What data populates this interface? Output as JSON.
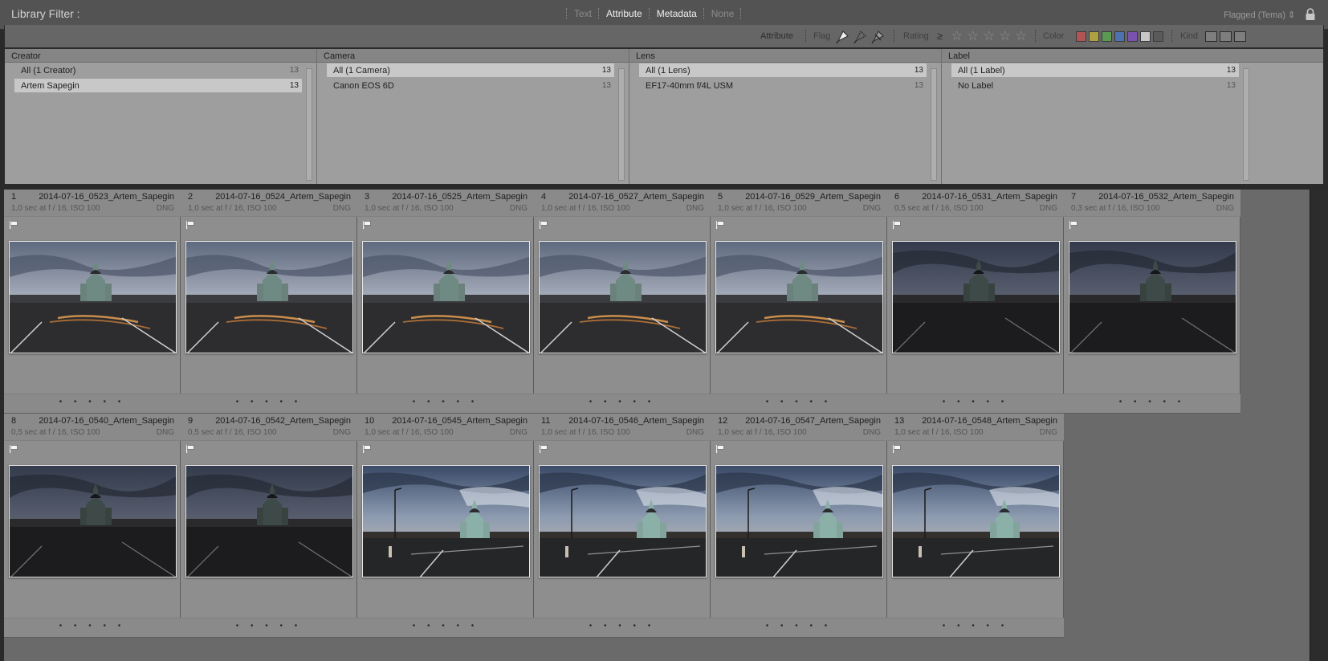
{
  "filter_bar": {
    "title": "Library Filter :",
    "modes": [
      {
        "label": "Text",
        "active": false
      },
      {
        "label": "Attribute",
        "active": true
      },
      {
        "label": "Metadata",
        "active": true
      },
      {
        "label": "None",
        "active": false
      }
    ],
    "preset": "Flagged (Tema) ⇕"
  },
  "attribute_bar": {
    "label": "Attribute",
    "flag_label": "Flag",
    "rating_label": "Rating",
    "rating_op": "≥",
    "stars": [
      "☆",
      "☆",
      "☆",
      "☆",
      "☆"
    ],
    "color_label": "Color",
    "colors": [
      "#b05454",
      "#b0a044",
      "#5c9a54",
      "#4e72b0",
      "#7a52b0",
      "#c8c8c8",
      "#5a5a5a"
    ],
    "kind_label": "Kind"
  },
  "metadata": {
    "columns": [
      {
        "header": "Creator",
        "rows": [
          {
            "label": "All (1 Creator)",
            "count": "13",
            "selected": false
          },
          {
            "label": "Artem Sapegin",
            "count": "13",
            "selected": true
          }
        ]
      },
      {
        "header": "Camera",
        "rows": [
          {
            "label": "All (1 Camera)",
            "count": "13",
            "selected": true
          },
          {
            "label": "Canon EOS 6D",
            "count": "13",
            "selected": false
          }
        ]
      },
      {
        "header": "Lens",
        "rows": [
          {
            "label": "All (1 Lens)",
            "count": "13",
            "selected": true
          },
          {
            "label": "EF17-40mm f/4L USM",
            "count": "13",
            "selected": false
          }
        ]
      },
      {
        "header": "Label",
        "rows": [
          {
            "label": "All (1 Label)",
            "count": "13",
            "selected": true
          },
          {
            "label": "No Label",
            "count": "13",
            "selected": false
          }
        ]
      }
    ]
  },
  "grid": {
    "items": [
      {
        "index": "1",
        "name": "2014-07-16_0523_Artem_Sapegin",
        "info": "1,0 sec at f / 16, ISO 100",
        "ext": "DNG",
        "scene": "a",
        "dots": "• • • • •"
      },
      {
        "index": "2",
        "name": "2014-07-16_0524_Artem_Sapegin",
        "info": "1,0 sec at f / 16, ISO 100",
        "ext": "DNG",
        "scene": "a",
        "dots": "• • • • •"
      },
      {
        "index": "3",
        "name": "2014-07-16_0525_Artem_Sapegin",
        "info": "1,0 sec at f / 16, ISO 100",
        "ext": "DNG",
        "scene": "a",
        "dots": "• • • • •"
      },
      {
        "index": "4",
        "name": "2014-07-16_0527_Artem_Sapegin",
        "info": "1,0 sec at f / 16, ISO 100",
        "ext": "DNG",
        "scene": "a",
        "dots": "• • • • •"
      },
      {
        "index": "5",
        "name": "2014-07-16_0529_Artem_Sapegin",
        "info": "1,0 sec at f / 16, ISO 100",
        "ext": "DNG",
        "scene": "a",
        "dots": "• • • • •"
      },
      {
        "index": "6",
        "name": "2014-07-16_0531_Artem_Sapegin",
        "info": "0,5 sec at f / 16, ISO 100",
        "ext": "DNG",
        "scene": "b",
        "dots": "• • • • •"
      },
      {
        "index": "7",
        "name": "2014-07-16_0532_Artem_Sapegin",
        "info": "0,3 sec at f / 16, ISO 100",
        "ext": "DNG",
        "scene": "b",
        "dots": "• • • • •"
      },
      {
        "index": "8",
        "name": "2014-07-16_0540_Artem_Sapegin",
        "info": "0,5 sec at f / 16, ISO 100",
        "ext": "DNG",
        "scene": "b",
        "dots": "• • • • •"
      },
      {
        "index": "9",
        "name": "2014-07-16_0542_Artem_Sapegin",
        "info": "0,5 sec at f / 16, ISO 100",
        "ext": "DNG",
        "scene": "b",
        "dots": "• • • • •"
      },
      {
        "index": "10",
        "name": "2014-07-16_0545_Artem_Sapegin",
        "info": "1,0 sec at f / 16, ISO 100",
        "ext": "DNG",
        "scene": "c",
        "dots": "• • • • •"
      },
      {
        "index": "11",
        "name": "2014-07-16_0546_Artem_Sapegin",
        "info": "1,0 sec at f / 16, ISO 100",
        "ext": "DNG",
        "scene": "c",
        "dots": "• • • • •"
      },
      {
        "index": "12",
        "name": "2014-07-16_0547_Artem_Sapegin",
        "info": "1,0 sec at f / 16, ISO 100",
        "ext": "DNG",
        "scene": "c",
        "dots": "• • • • •"
      },
      {
        "index": "13",
        "name": "2014-07-16_0548_Artem_Sapegin",
        "info": "1,0 sec at f / 16, ISO 100",
        "ext": "DNG",
        "scene": "c",
        "dots": "• • • • •"
      }
    ]
  }
}
